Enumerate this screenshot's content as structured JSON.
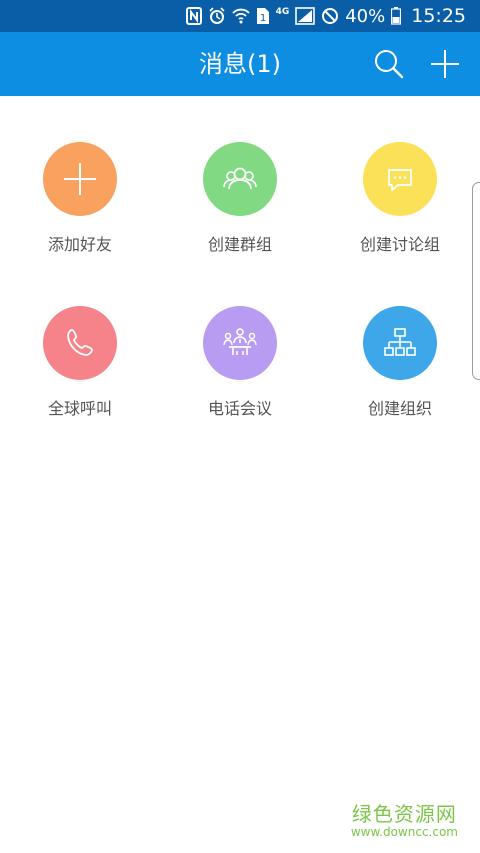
{
  "status_bar": {
    "network": "4G",
    "sim": "1",
    "battery": "40%",
    "time": "15:25",
    "icons": [
      "nfc-icon",
      "alarm-icon",
      "wifi-icon",
      "sim-icon",
      "signal-icon",
      "do-not-disturb-icon",
      "battery-icon"
    ]
  },
  "appbar": {
    "title": "消息(1)",
    "actions": [
      "search-icon",
      "plus-icon"
    ],
    "color": "#0d8ee3"
  },
  "grid": [
    {
      "label": "添加好友",
      "color": "#f9a15e",
      "icon": "plus-icon"
    },
    {
      "label": "创建群组",
      "color": "#82d983",
      "icon": "group-icon"
    },
    {
      "label": "创建讨论组",
      "color": "#fbe158",
      "icon": "chat-bubble-icon"
    },
    {
      "label": "全球呼叫",
      "color": "#f6838a",
      "icon": "phone-icon"
    },
    {
      "label": "电话会议",
      "color": "#b79cf1",
      "icon": "conference-icon"
    },
    {
      "label": "创建组织",
      "color": "#3da7ea",
      "icon": "org-chart-icon"
    }
  ],
  "watermark": {
    "main": "绿色资源网",
    "sub": "www.downcc.com"
  }
}
